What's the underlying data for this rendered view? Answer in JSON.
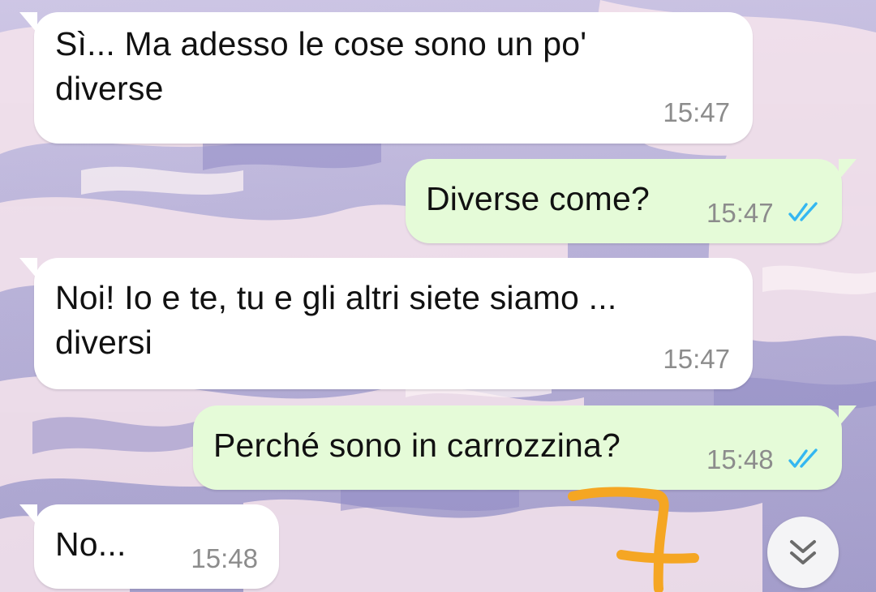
{
  "messages": [
    {
      "direction": "in",
      "text": "Sì... Ma adesso le cose sono un po'\ndiverse",
      "time": "15:47"
    },
    {
      "direction": "out",
      "text": "Diverse come?",
      "time": "15:47",
      "status": "read"
    },
    {
      "direction": "in",
      "text": "Noi! Io e te, tu e gli altri siete siamo ...\ndiversi",
      "time": "15:47"
    },
    {
      "direction": "out",
      "text": "Perché sono in carrozzina?",
      "time": "15:48",
      "status": "read"
    },
    {
      "direction": "in",
      "text": "No...",
      "time": "15:48"
    }
  ],
  "scroll_button": {
    "icon": "double-chevron-down-icon"
  },
  "colors": {
    "incoming_bubble": "#ffffff",
    "outgoing_bubble": "#e5fbd8",
    "read_ticks": "#34b7f1",
    "annotation": "#f5a623"
  }
}
